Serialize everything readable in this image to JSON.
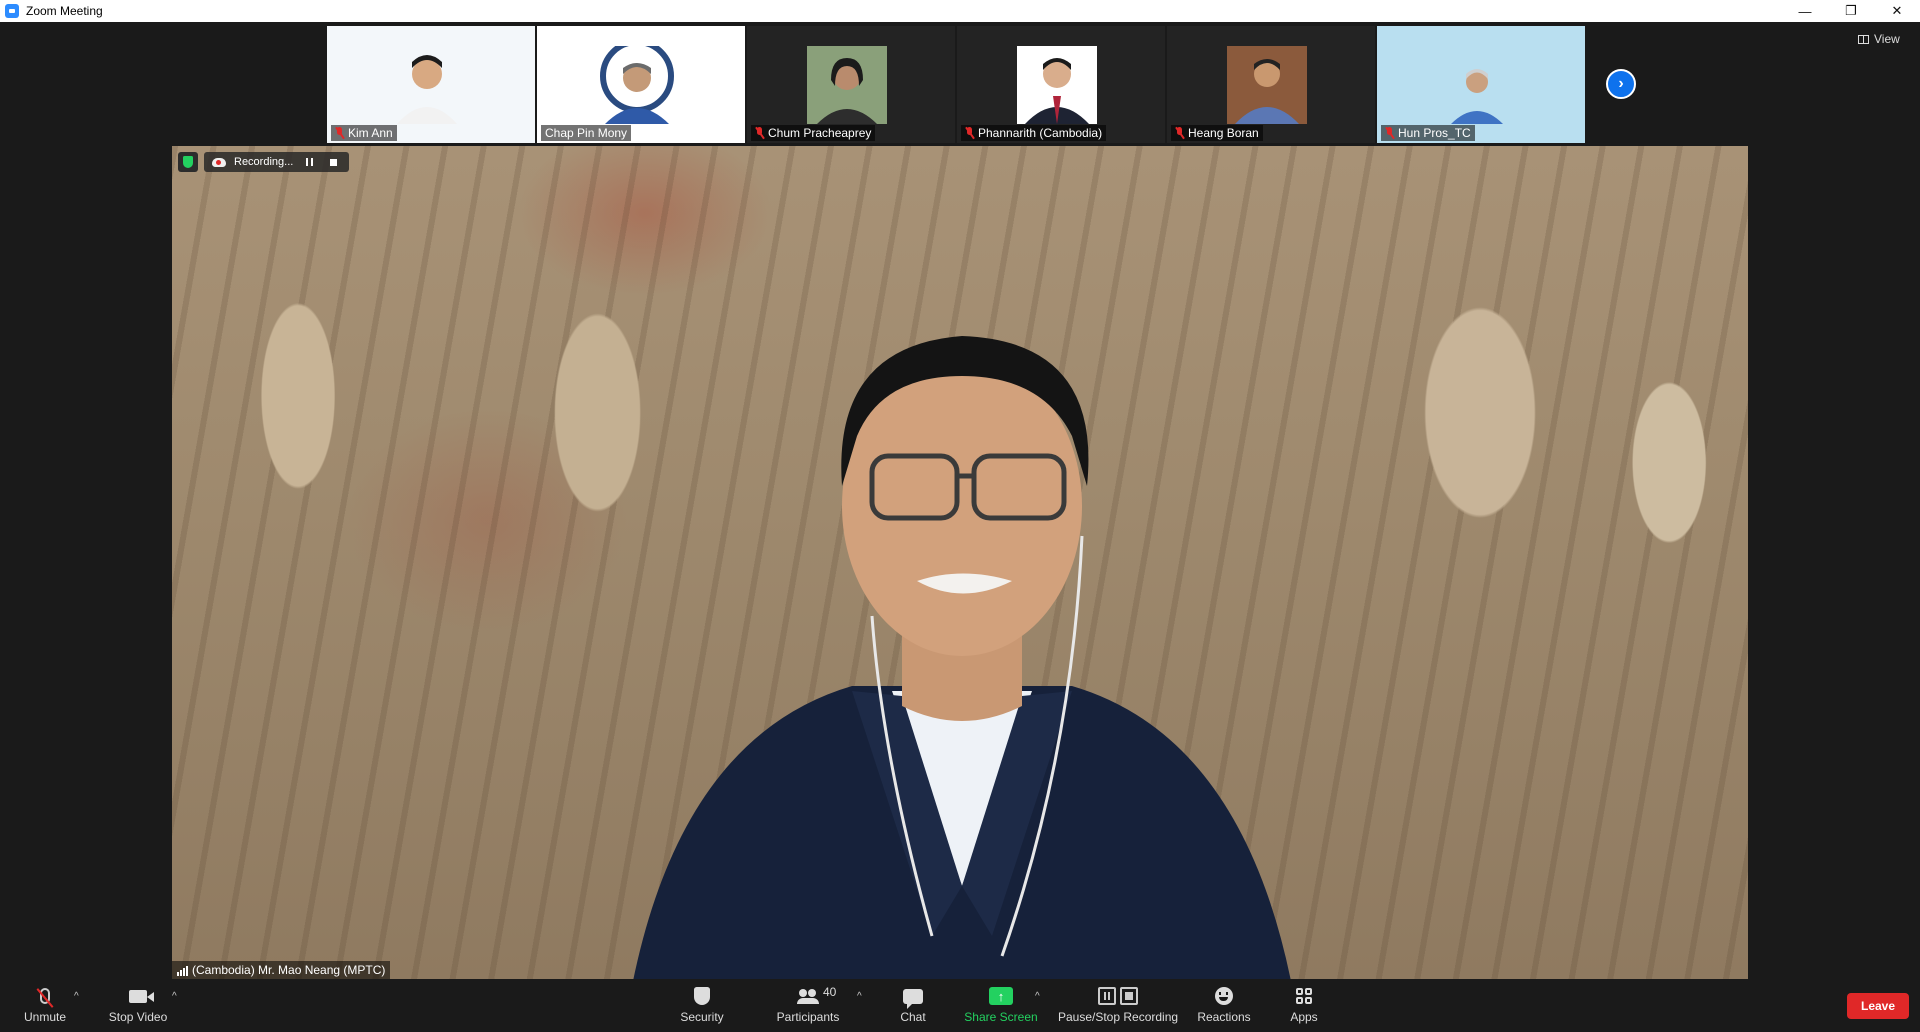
{
  "window": {
    "title": "Zoom Meeting",
    "minimize": "—",
    "maximize": "❐",
    "close": "✕"
  },
  "view_label": "View",
  "thumbnails": [
    {
      "name": "Kim Ann",
      "muted": true
    },
    {
      "name": "Chap Pin Mony",
      "muted": false
    },
    {
      "name": "Chum Pracheaprey",
      "muted": true
    },
    {
      "name": "Phannarith (Cambodia)",
      "muted": true
    },
    {
      "name": "Heang Boran",
      "muted": true
    },
    {
      "name": "Hun Pros_TC",
      "muted": true
    }
  ],
  "next_arrow": "›",
  "recording": {
    "label": "Recording..."
  },
  "main_speaker": {
    "name": "(Cambodia) Mr. Mao Neang (MPTC)"
  },
  "toolbar": {
    "unmute": "Unmute",
    "stop_video": "Stop Video",
    "security": "Security",
    "participants": "Participants",
    "participants_count": "40",
    "chat": "Chat",
    "share_screen": "Share Screen",
    "share_arrow": "↑",
    "pause_stop_recording": "Pause/Stop Recording",
    "reactions": "Reactions",
    "apps": "Apps",
    "leave": "Leave",
    "caret": "^"
  },
  "colors": {
    "accent": "#0e72ed",
    "leave": "#e02828",
    "share": "#23d160",
    "muted": "#e02828"
  }
}
